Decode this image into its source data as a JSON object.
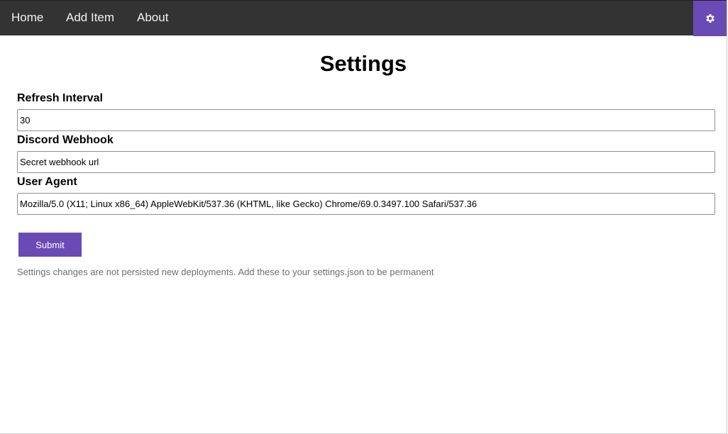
{
  "nav": {
    "home": "Home",
    "add_item": "Add Item",
    "about": "About",
    "settings_icon": "gear-icon"
  },
  "page": {
    "title": "Settings"
  },
  "form": {
    "refresh_interval": {
      "label": "Refresh Interval",
      "value": "30"
    },
    "discord_webhook": {
      "label": "Discord Webhook",
      "value": "Secret webhook url"
    },
    "user_agent": {
      "label": "User Agent",
      "value": "Mozilla/5.0 (X11; Linux x86_64) AppleWebKit/537.36 (KHTML, like Gecko) Chrome/69.0.3497.100 Safari/537.36"
    },
    "submit_label": "Submit",
    "note": "Settings changes are not persisted new deployments. Add these to your settings.json to be permanent"
  },
  "colors": {
    "nav_background": "#333333",
    "accent": "#6a4ab5",
    "note_text": "#6e6e6e"
  }
}
